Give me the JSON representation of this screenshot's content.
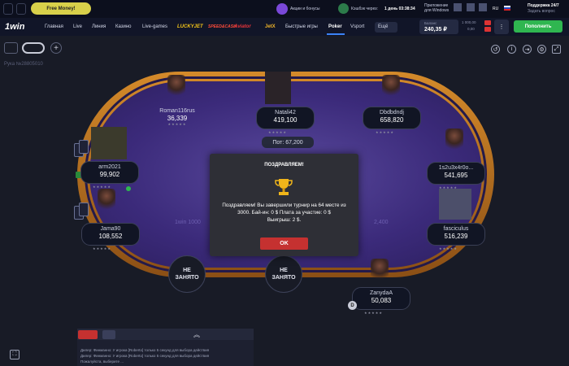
{
  "promo": {
    "free_money": "Free Money!",
    "promo_text": "Акции и бонусы",
    "cashback_text": "Кэшбэк через:",
    "cashback_timer": "1 день 03:38:34",
    "app_text": "Приложение\nдля Windows",
    "language": "RU",
    "support_title": "Поддержка 24/7",
    "support_sub": "Задать вопрос"
  },
  "nav": {
    "logo": "1win",
    "items": [
      "Главная",
      "Live",
      "Линия",
      "Казино",
      "Live-games",
      "LUCKYJET",
      "SPEED&CASH",
      "Aviator",
      "JetX",
      "Быстрые игры",
      "Poker",
      "Vsport",
      "Ещё"
    ],
    "active_item": "Poker",
    "balance_label": "Баланс",
    "balance_value": "240,35 ₽",
    "bonus_1": "1 000,00",
    "bonus_2": "0,00",
    "deposit_button": "Пополнить"
  },
  "game": {
    "hand_id": "Рука №28805010",
    "pot": "Пот: 67,200",
    "ghost_left": "1win 1000",
    "ghost_right": "2,400",
    "players": [
      {
        "name": "Roman116rus",
        "chips": "36,339"
      },
      {
        "name": "Natali42",
        "chips": "419,100"
      },
      {
        "name": "Dbdbdndj",
        "chips": "658,820"
      },
      {
        "name": "arm2021",
        "chips": "99,902"
      },
      {
        "name": "1s2u3x4r0o...",
        "chips": "541,695"
      },
      {
        "name": "Jama90",
        "chips": "108,552"
      },
      {
        "name": "fasciculus",
        "chips": "516,239"
      },
      {
        "name": "ZanydaA",
        "chips": "50,083"
      }
    ],
    "empty_seat": "НЕ\nЗАНЯТО",
    "stars": "★★★★★"
  },
  "modal": {
    "title": "ПОЗДРАВЛЯЕМ!",
    "message": "Поздравляем! Вы завершили турнир на 64 месте из 3000. Бай-ин: 0 $ Плата за участие: 0 $",
    "winnings": "Выигрыш: 2 $.",
    "ok_button": "OK"
  },
  "chat": {
    "lines": [
      "Дилер: Финманно: У игрока [Roberto] только 5 секунд для выбора действия",
      "Дилер: Финманно: У игрока [Roberto] только 5 секунд для выбора действия",
      "Пожалуйста, выберите ..."
    ]
  },
  "colors": {
    "accent_green": "#2fb650",
    "ok_red": "#c53130",
    "felt": "#3b2a7a",
    "rail": "#c07a25"
  }
}
